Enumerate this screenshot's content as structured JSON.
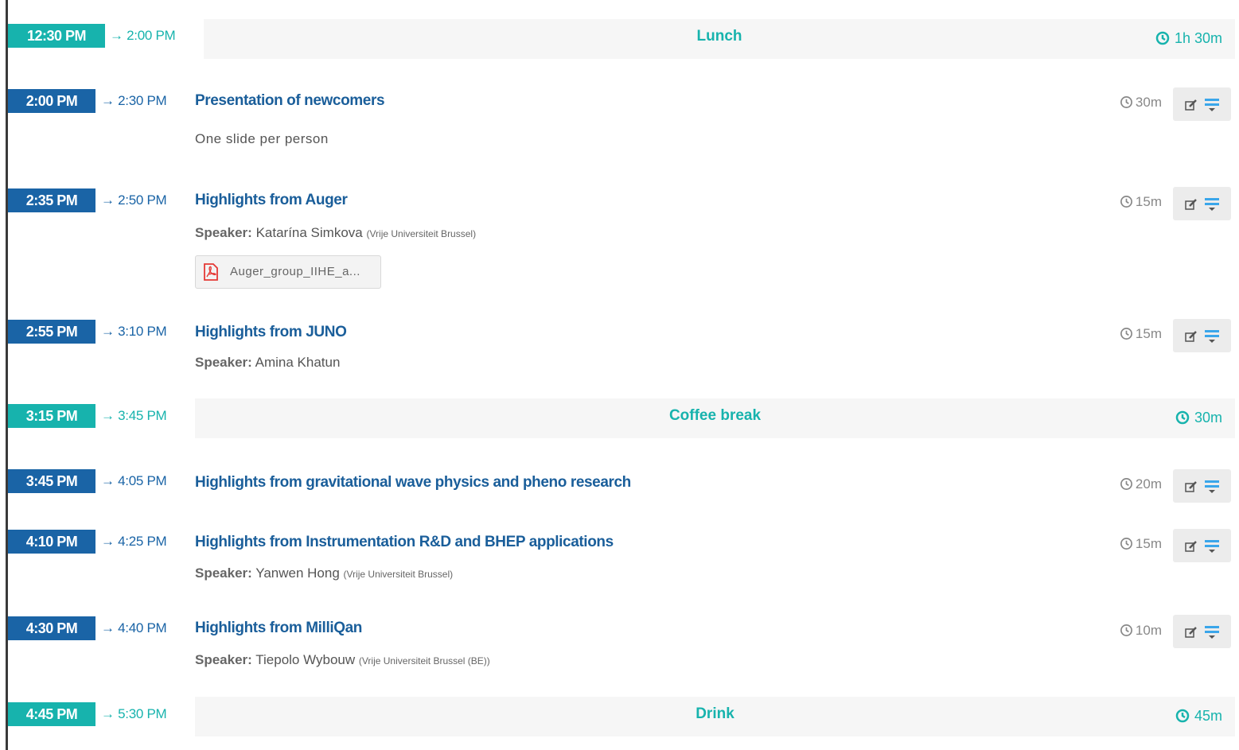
{
  "colors": {
    "contribution": "#1a64a6",
    "break": "#17b3ad"
  },
  "arrow": "→",
  "breaks": [
    {
      "start": "12:30 PM",
      "end": "2:00 PM",
      "title": "Lunch",
      "duration": "1h 30m"
    },
    {
      "start": "3:15 PM",
      "end": "3:45 PM",
      "title": "Coffee break",
      "duration": "30m"
    },
    {
      "start": "4:45 PM",
      "end": "5:30 PM",
      "title": "Drink",
      "duration": "45m"
    }
  ],
  "contributions": [
    {
      "start": "2:00 PM",
      "end": "2:30 PM",
      "title": "Presentation of newcomers",
      "duration": "30m",
      "description": "One slide per person"
    },
    {
      "start": "2:35 PM",
      "end": "2:50 PM",
      "title": "Highlights from Auger",
      "duration": "15m",
      "speaker_label": "Speaker:",
      "speaker": "Katarína Simkova",
      "affiliation": "(Vrije Universiteit Brussel)",
      "attachment": "Auger_group_IIHE_a..."
    },
    {
      "start": "2:55 PM",
      "end": "3:10 PM",
      "title": "Highlights from JUNO",
      "duration": "15m",
      "speaker_label": "Speaker:",
      "speaker": "Amina Khatun"
    },
    {
      "start": "3:45 PM",
      "end": "4:05 PM",
      "title": "Highlights from gravitational wave physics and pheno research",
      "duration": "20m"
    },
    {
      "start": "4:10 PM",
      "end": "4:25 PM",
      "title": "Highlights from Instrumentation R&D and BHEP applications",
      "duration": "15m",
      "speaker_label": "Speaker:",
      "speaker": "Yanwen Hong",
      "affiliation": "(Vrije Universiteit Brussel)"
    },
    {
      "start": "4:30 PM",
      "end": "4:40 PM",
      "title": "Highlights from MilliQan",
      "duration": "10m",
      "speaker_label": "Speaker:",
      "speaker": "Tiepolo Wybouw",
      "affiliation": "(Vrije Universiteit Brussel (BE))"
    }
  ]
}
